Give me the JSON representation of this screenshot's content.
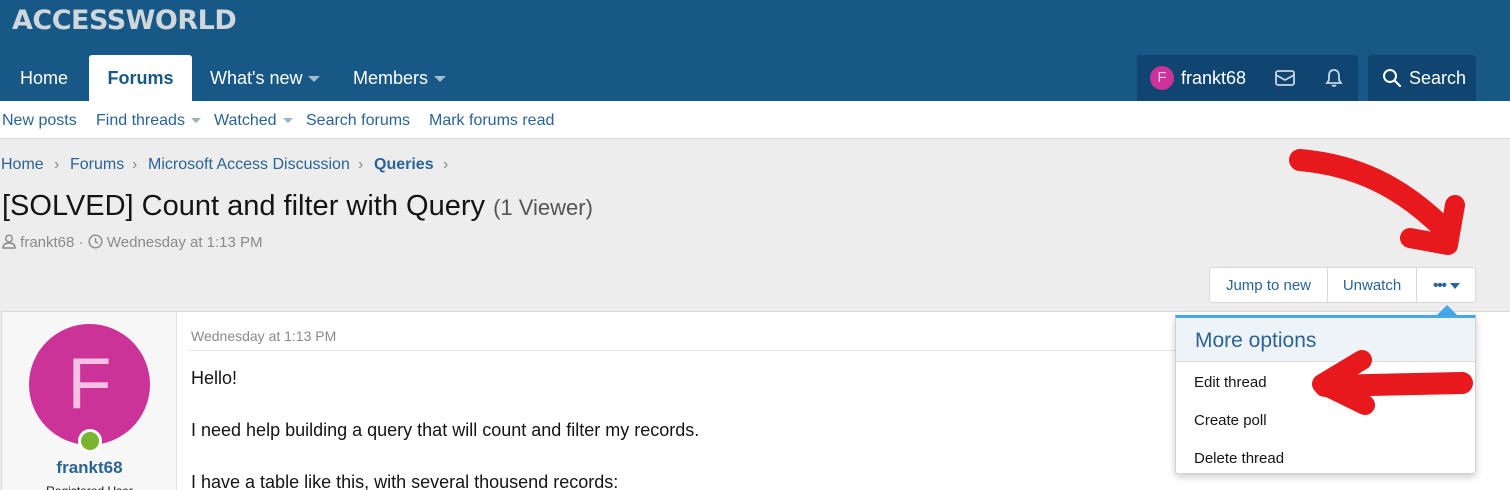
{
  "header": {
    "logo": "ACCESSWORLD",
    "nav": [
      {
        "label": "Home"
      },
      {
        "label": "Forums"
      },
      {
        "label": "What's new"
      },
      {
        "label": "Members"
      }
    ],
    "user": {
      "initial": "F",
      "name": "frankt68"
    },
    "search_label": "Search"
  },
  "subnav": [
    "New posts",
    "Find threads",
    "Watched",
    "Search forums",
    "Mark forums read"
  ],
  "breadcrumb": [
    "Home",
    "Forums",
    "Microsoft Access Discussion",
    "Queries"
  ],
  "thread": {
    "title": "[SOLVED] Count and filter with Query",
    "viewers": "(1 Viewer)",
    "author": "frankt68",
    "date": "Wednesday at 1:13 PM"
  },
  "buttons": {
    "jump": "Jump to new",
    "unwatch": "Unwatch",
    "more": "•••"
  },
  "dropdown": {
    "title": "More options",
    "items": [
      "Edit thread",
      "Create poll",
      "Delete thread"
    ]
  },
  "post": {
    "avatar_initial": "F",
    "username": "frankt68",
    "role": "Registered User",
    "date": "Wednesday at 1:13 PM",
    "lines": [
      "Hello!",
      "I need help building a query that will count and filter my records.",
      "I have a table like this, with several thousend records:"
    ]
  },
  "colors": {
    "header": "#185886",
    "accent": "#2a6496",
    "avatar": "#cc3399",
    "annotation": "#e8191c"
  }
}
